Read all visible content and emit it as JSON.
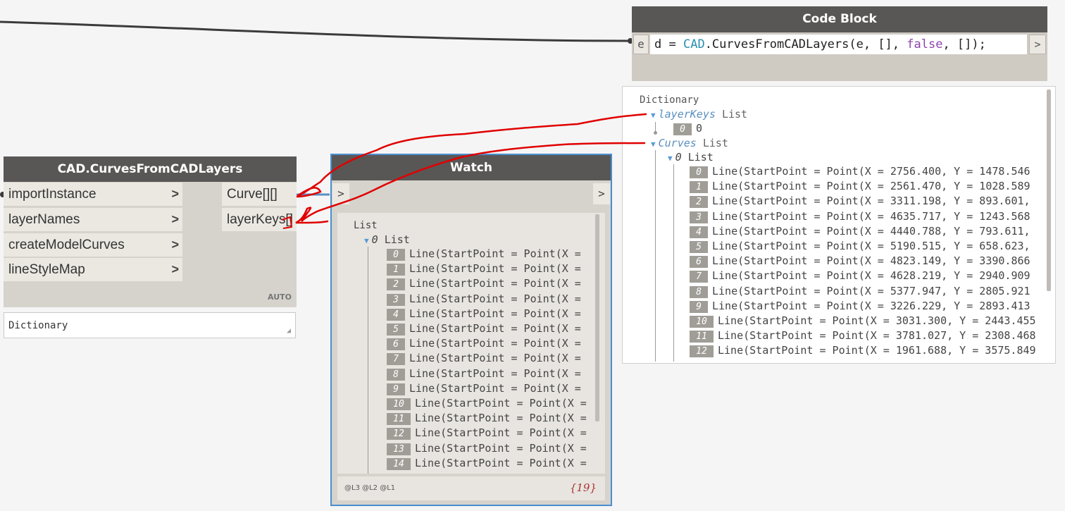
{
  "code_block": {
    "title": "Code Block",
    "input_port": "e",
    "output_port": ">",
    "code": {
      "var": "d",
      "eq": " = ",
      "cls": "CAD",
      "method": ".CurvesFromCADLayers(e, [], ",
      "kw": "false",
      "tail": ", []);"
    }
  },
  "cad_node": {
    "title": "CAD.CurvesFromCADLayers",
    "inputs": [
      "importInstance",
      "layerNames",
      "createModelCurves",
      "lineStyleMap"
    ],
    "outputs": [
      "Curve[][]",
      "layerKeys[]"
    ],
    "chevron": ">",
    "lacing": "AUTO",
    "preview": "Dictionary",
    "grip": "◢"
  },
  "watch": {
    "title": "Watch",
    "input_port": ">",
    "output_port": ">",
    "root": "List",
    "sub_index": "0",
    "sub_label": "List",
    "items": [
      {
        "i": "0",
        "text": "Line(StartPoint = Point(X ="
      },
      {
        "i": "1",
        "text": "Line(StartPoint = Point(X ="
      },
      {
        "i": "2",
        "text": "Line(StartPoint = Point(X ="
      },
      {
        "i": "3",
        "text": "Line(StartPoint = Point(X ="
      },
      {
        "i": "4",
        "text": "Line(StartPoint = Point(X ="
      },
      {
        "i": "5",
        "text": "Line(StartPoint = Point(X ="
      },
      {
        "i": "6",
        "text": "Line(StartPoint = Point(X ="
      },
      {
        "i": "7",
        "text": "Line(StartPoint = Point(X ="
      },
      {
        "i": "8",
        "text": "Line(StartPoint = Point(X ="
      },
      {
        "i": "9",
        "text": "Line(StartPoint = Point(X ="
      },
      {
        "i": "10",
        "text": "Line(StartPoint = Point(X ="
      },
      {
        "i": "11",
        "text": "Line(StartPoint = Point(X ="
      },
      {
        "i": "12",
        "text": "Line(StartPoint = Point(X ="
      },
      {
        "i": "13",
        "text": "Line(StartPoint = Point(X ="
      },
      {
        "i": "14",
        "text": "Line(StartPoint = Point(X ="
      }
    ],
    "levels": "@L3 @L2 @L1",
    "count": "{19}"
  },
  "dictionary": {
    "root": "Dictionary",
    "layer_keys_label": "layerKeys",
    "layer_keys_type": "List",
    "layer_key_index": "0",
    "layer_key_value": "0",
    "curves_label": "Curves",
    "curves_type": "List",
    "curves_sub_index": "0",
    "curves_sub_label": "List",
    "items": [
      {
        "i": "0",
        "text": "Line(StartPoint = Point(X = 2756.400, Y = 1478.546"
      },
      {
        "i": "1",
        "text": "Line(StartPoint = Point(X = 2561.470, Y = 1028.589"
      },
      {
        "i": "2",
        "text": "Line(StartPoint = Point(X = 3311.198, Y = 893.601,"
      },
      {
        "i": "3",
        "text": "Line(StartPoint = Point(X = 4635.717, Y = 1243.568"
      },
      {
        "i": "4",
        "text": "Line(StartPoint = Point(X = 4440.788, Y = 793.611,"
      },
      {
        "i": "5",
        "text": "Line(StartPoint = Point(X = 5190.515, Y = 658.623,"
      },
      {
        "i": "6",
        "text": "Line(StartPoint = Point(X = 4823.149, Y = 3390.866"
      },
      {
        "i": "7",
        "text": "Line(StartPoint = Point(X = 4628.219, Y = 2940.909"
      },
      {
        "i": "8",
        "text": "Line(StartPoint = Point(X = 5377.947, Y = 2805.921"
      },
      {
        "i": "9",
        "text": "Line(StartPoint = Point(X = 3226.229, Y = 2893.413"
      },
      {
        "i": "10",
        "text": "Line(StartPoint = Point(X = 3031.300, Y = 2443.455"
      },
      {
        "i": "11",
        "text": "Line(StartPoint = Point(X = 3781.027, Y = 2308.468"
      },
      {
        "i": "12",
        "text": "Line(StartPoint = Point(X = 1961.688, Y = 3575.849"
      }
    ]
  },
  "colors": {
    "header": "#595756",
    "node_body": "#d6d3cd",
    "selection": "#4a8fd0",
    "annotation": "#e00000"
  }
}
